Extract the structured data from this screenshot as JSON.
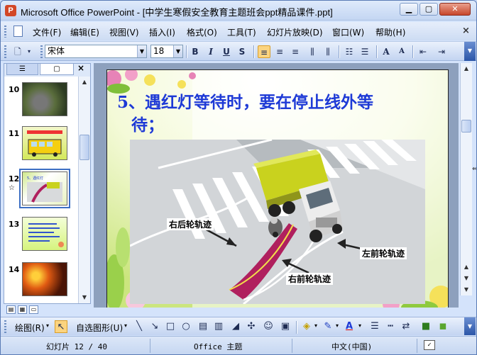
{
  "window": {
    "title": "Microsoft Office PowerPoint - [中学生寒假安全教育主题班会ppt精品课件.ppt]",
    "app_icon_letter": "P",
    "buttons": {
      "minimize": "▁",
      "maximize": "▢",
      "close": "✕"
    }
  },
  "menu": {
    "items": [
      {
        "label": "文件(F)"
      },
      {
        "label": "编辑(E)"
      },
      {
        "label": "视图(V)"
      },
      {
        "label": "插入(I)"
      },
      {
        "label": "格式(O)"
      },
      {
        "label": "工具(T)"
      },
      {
        "label": "幻灯片放映(D)"
      },
      {
        "label": "窗口(W)"
      },
      {
        "label": "帮助(H)"
      }
    ],
    "close_glyph": "×"
  },
  "toolbar": {
    "font_name": "宋体",
    "font_size": "18",
    "bold": "B",
    "italic": "I",
    "underline": "U",
    "shadow": "S",
    "grow_font": "A",
    "shrink_font": "A"
  },
  "side_panel": {
    "tab_outline_glyph": "☰",
    "tab_slides_glyph": "▢",
    "close_glyph": "×",
    "slides": [
      {
        "number": "10"
      },
      {
        "number": "11"
      },
      {
        "number": "12",
        "mark": "☆"
      },
      {
        "number": "13"
      },
      {
        "number": "14"
      }
    ]
  },
  "slide": {
    "title_line1": "5、遇红灯等待时，要在停止线外等",
    "title_line2": "待；",
    "labels": {
      "rear_wheel": "右后轮轨迹",
      "front_left_wheel": "左前轮轨迹",
      "front_right_wheel": "右前轮轨迹"
    }
  },
  "drawing_toolbar": {
    "draw_label": "绘图(R)",
    "autoshapes_label": "自选图形(U)"
  },
  "status": {
    "slide_info": "幻灯片 12 / 40",
    "theme": "Office 主题",
    "language": "中文(中国)"
  },
  "colors": {
    "title_blue": "#1e3ad6",
    "truck_yellow": "#c9d21e",
    "track_magenta": "#b0205e"
  }
}
